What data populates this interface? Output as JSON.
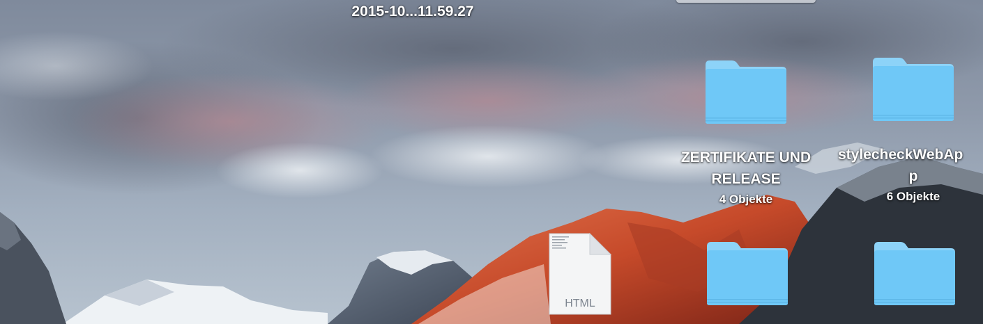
{
  "desktop": {
    "top_item": {
      "name": "2015-10...11.59.27"
    },
    "items": [
      {
        "name_line1": "ZERTIFIKATE UND",
        "name_line2": "RELEASE",
        "count": "4 Objekte"
      },
      {
        "name_line1": "stylecheckWebAp",
        "name_line2": "p",
        "count": "6 Objekte"
      }
    ],
    "html_file": {
      "type_label": "HTML"
    },
    "colors": {
      "folder": "#6fc8f7",
      "folder_tab": "#8dd3f8",
      "label": "#ffffff"
    }
  }
}
